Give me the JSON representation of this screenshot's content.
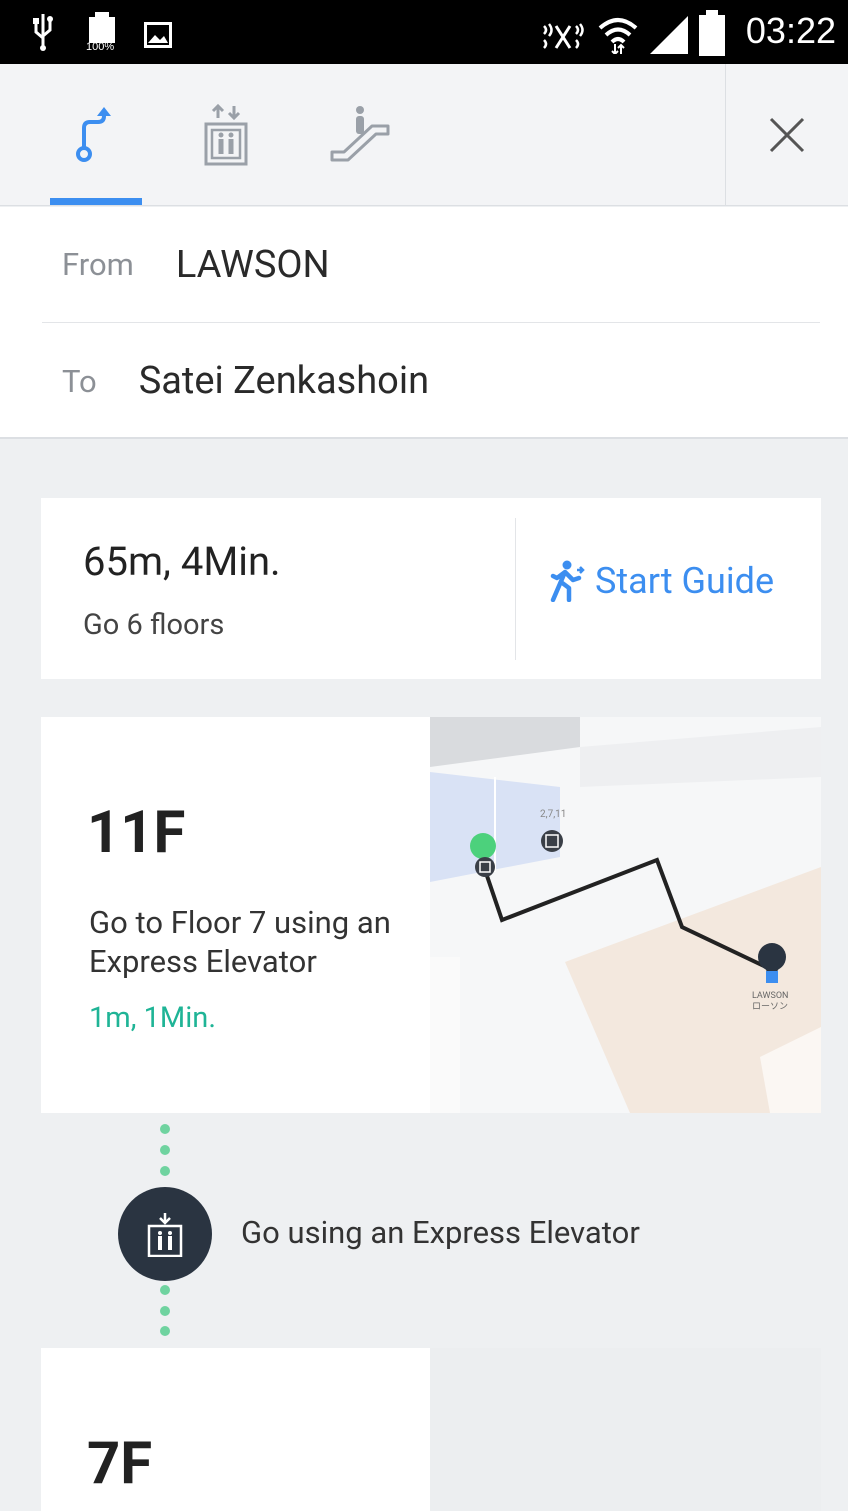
{
  "status_bar": {
    "battery_percent": "100%",
    "time": "03:22"
  },
  "mode_tabs": [
    {
      "name": "route",
      "active": true
    },
    {
      "name": "elevator",
      "active": false
    },
    {
      "name": "escalator",
      "active": false
    }
  ],
  "route": {
    "from_label": "From",
    "from_value": "LAWSON",
    "to_label": "To",
    "to_value": "Satei Zenkashoin"
  },
  "summary": {
    "distance_time": "65m, 4Min.",
    "floors": "Go 6 floors",
    "start_guide_label": "Start Guide"
  },
  "steps": [
    {
      "floor": "11F",
      "instruction": "Go to Floor 7 using an Express Elevator",
      "meta": "1m, 1Min.",
      "map": {
        "elevator_tag": "2,7,11",
        "destination_label_en": "LAWSON",
        "destination_label_jp": "ローソン"
      }
    },
    {
      "floor": "7F"
    }
  ],
  "connector": {
    "text": "Go using an Express Elevator"
  },
  "colors": {
    "accent": "#3c8ef0",
    "meta_green": "#1fb496",
    "connector_bg": "#2a3441",
    "dot_green": "#6fd3a0",
    "background": "#eef0f2"
  }
}
